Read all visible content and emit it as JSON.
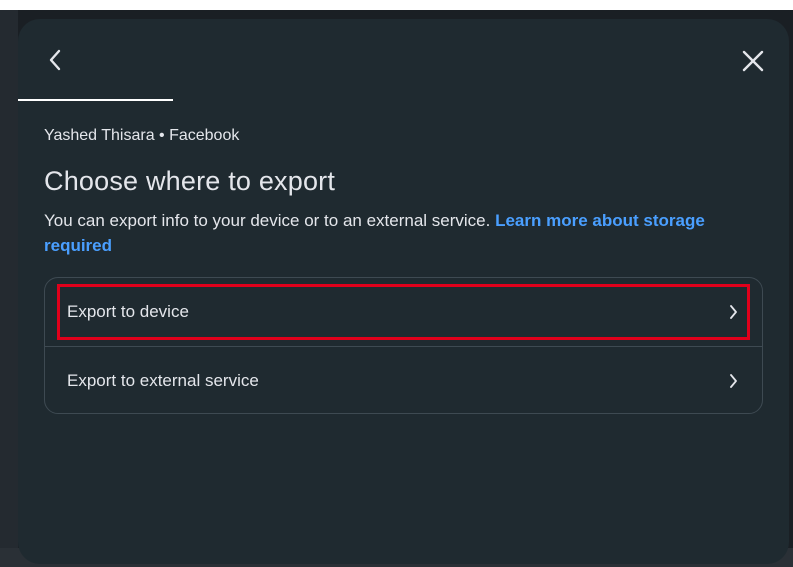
{
  "modal": {
    "account": "Yashed Thisara • Facebook",
    "title": "Choose where to export",
    "description_text": "You can export info to your device or to an external service. ",
    "learn_more_link": "Learn more about storage required",
    "options": [
      {
        "label": "Export to device",
        "highlighted": true
      },
      {
        "label": "Export to external service",
        "highlighted": false
      }
    ]
  },
  "colors": {
    "modal_bg": "#1f2a30",
    "text": "#e4e6eb",
    "link": "#4a9fff",
    "highlight": "#e0001b",
    "border": "#3e4a52"
  },
  "icons": {
    "back": "chevron-left-icon",
    "close": "close-icon",
    "option_arrow": "chevron-right-icon"
  }
}
